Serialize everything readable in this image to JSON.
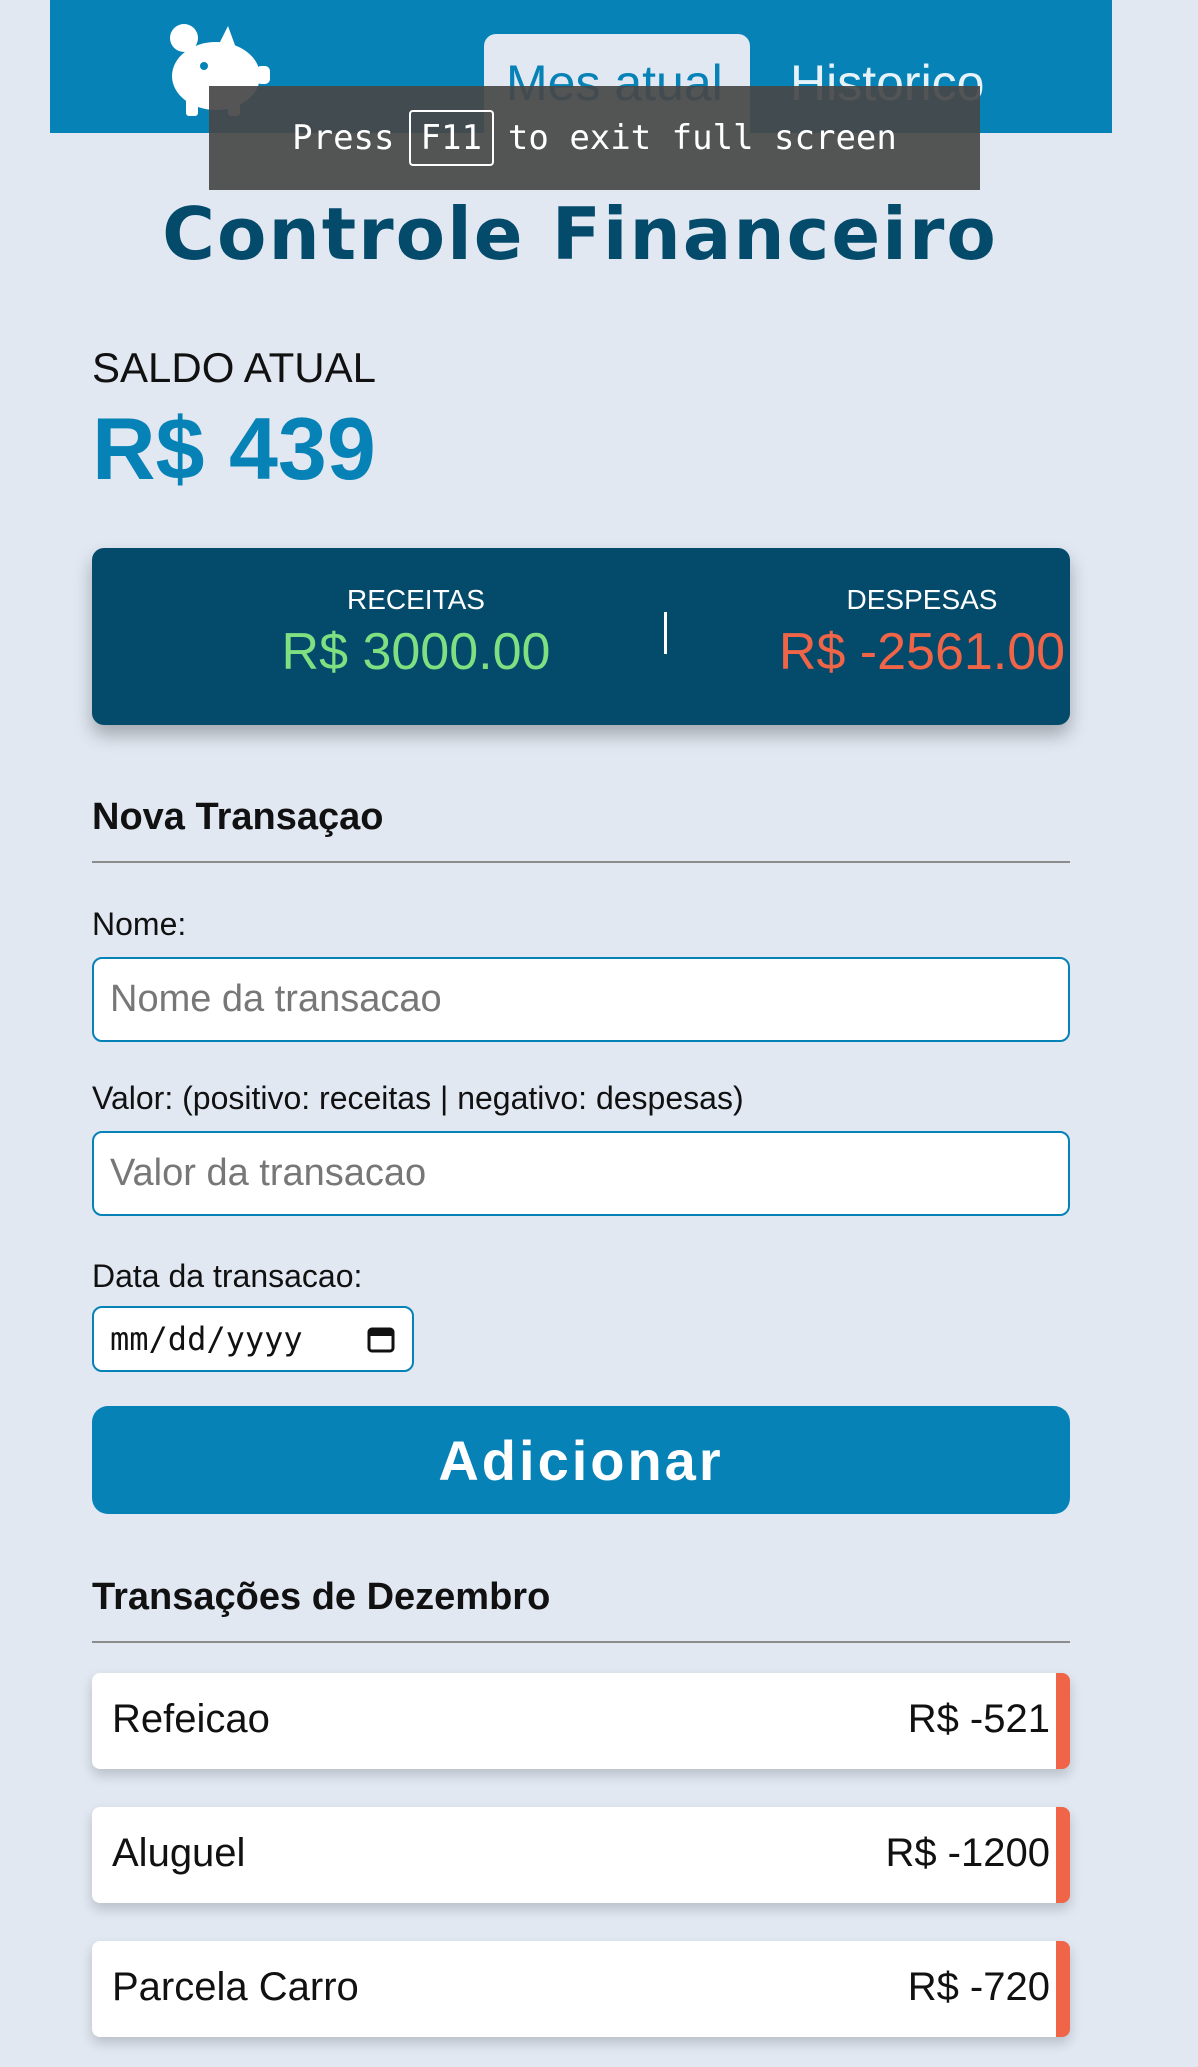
{
  "header": {
    "tabs": [
      {
        "label": "Mes atual",
        "active": true
      },
      {
        "label": "Historico",
        "active": false
      }
    ],
    "logo_icon": "piggy-bank-icon"
  },
  "fullscreen_notice": {
    "prefix": "Press",
    "key": "F11",
    "suffix": "to exit full screen"
  },
  "title": "Controle Financeiro",
  "balance": {
    "label": "SALDO ATUAL",
    "value": "R$ 439"
  },
  "summary": {
    "income_label": "RECEITAS",
    "income_value": "R$ 3000.00",
    "expense_label": "DESPESAS",
    "expense_value": "R$ -2561.00"
  },
  "form": {
    "title": "Nova Transaçao",
    "name_label": "Nome:",
    "name_placeholder": "Nome da transacao",
    "value_label": "Valor: (positivo: receitas | negativo: despesas)",
    "value_placeholder": "Valor da transacao",
    "date_label": "Data da transacao:",
    "date_placeholder": "mm/dd/yyyy",
    "submit_label": "Adicionar"
  },
  "transactions": {
    "title": "Transações de Dezembro",
    "items": [
      {
        "name": "Refeicao",
        "value": "R$ -521"
      },
      {
        "name": "Aluguel",
        "value": "R$ -1200"
      },
      {
        "name": "Parcela Carro",
        "value": "R$ -720"
      }
    ]
  },
  "colors": {
    "primary": "#0682b7",
    "dark": "#044a6b",
    "income": "#7ee081",
    "expense": "#f06447",
    "background": "#e1e8f2"
  }
}
